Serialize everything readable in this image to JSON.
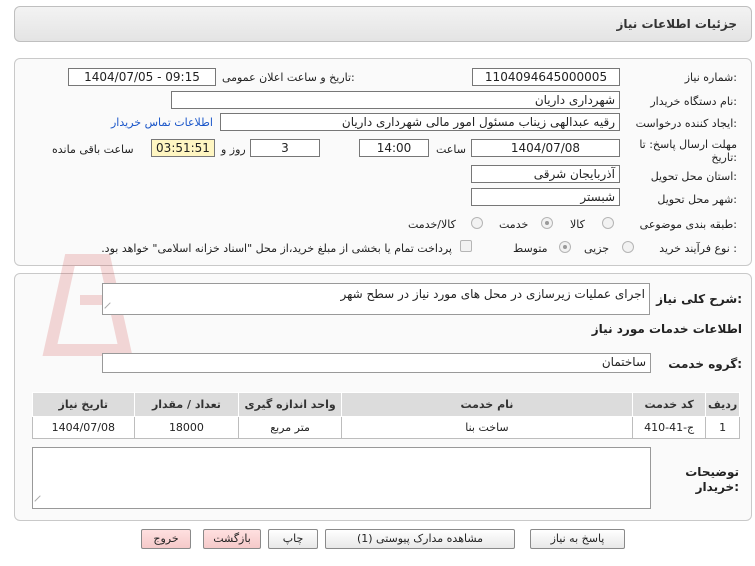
{
  "header": {
    "title": "جزئیات اطلاعات نیاز"
  },
  "details": {
    "need_number_label": "شماره نیاز:",
    "need_number": "1104094645000005",
    "announce_label": "تاریخ و ساعت اعلان عمومی:",
    "announce_value": "1404/07/05 - 09:15",
    "buyer_org_label": "نام دستگاه خریدار:",
    "buyer_org": "شهرداری داریان",
    "creator_label": "ایجاد کننده درخواست:",
    "creator": "رقیه عبدالهی زیناب مسئول امور مالی شهرداری داریان",
    "contact_link": "اطلاعات تماس خریدار",
    "deadline_label_1": "مهلت ارسال پاسخ: تا",
    "deadline_label_2": "تاریخ:",
    "deadline_date": "1404/07/08",
    "time_label": "ساعت",
    "deadline_time": "14:00",
    "days_value": "3",
    "days_label": "روز و",
    "remaining_time": "03:51:51",
    "remaining_label": "ساعت باقی مانده",
    "province_label": "استان محل تحویل:",
    "province": "آذربایجان شرقی",
    "city_label": "شهر محل تحویل:",
    "city": "شبستر",
    "category_label": "طبقه بندی موضوعی:",
    "category_options": [
      "کالا",
      "خدمت",
      "کالا/خدمت"
    ],
    "category_selected": "خدمت",
    "process_label": "نوع فرآیند خرید :",
    "process_options": [
      "جزیی",
      "متوسط"
    ],
    "process_selected": "متوسط",
    "payment_note": "پرداخت تمام یا بخشی از مبلغ خرید،از محل \"اسناد خزانه اسلامی\" خواهد بود."
  },
  "description": {
    "label": "شرح کلی نیاز:",
    "value": "اجرای عملیات زیرسازی در محل های مورد نیاز در سطح شهر"
  },
  "services": {
    "section_title": "اطلاعات خدمات مورد نیاز",
    "group_label": "گروه خدمت:",
    "group_value": "ساختمان",
    "columns": [
      "ردیف",
      "کد خدمت",
      "نام خدمت",
      "واحد اندازه گیری",
      "تعداد / مقدار",
      "تاریخ نیاز"
    ],
    "rows": [
      [
        "1",
        "ج-41-410",
        "ساخت بنا",
        "متر مربع",
        "18000",
        "1404/07/08"
      ]
    ]
  },
  "buyer_notes": {
    "label_1": "توضیحات",
    "label_2": "خریدار:",
    "value": ""
  },
  "buttons": {
    "reply": "پاسخ به نیاز",
    "attachments": "مشاهده مدارک پیوستی (1)",
    "print": "چاپ",
    "back": "بازگشت",
    "exit": "خروج"
  },
  "colors": {
    "accent_link": "#1a56c9",
    "remaining_bg": "#fff6c2",
    "exit_bg": "#f5c9c9"
  }
}
